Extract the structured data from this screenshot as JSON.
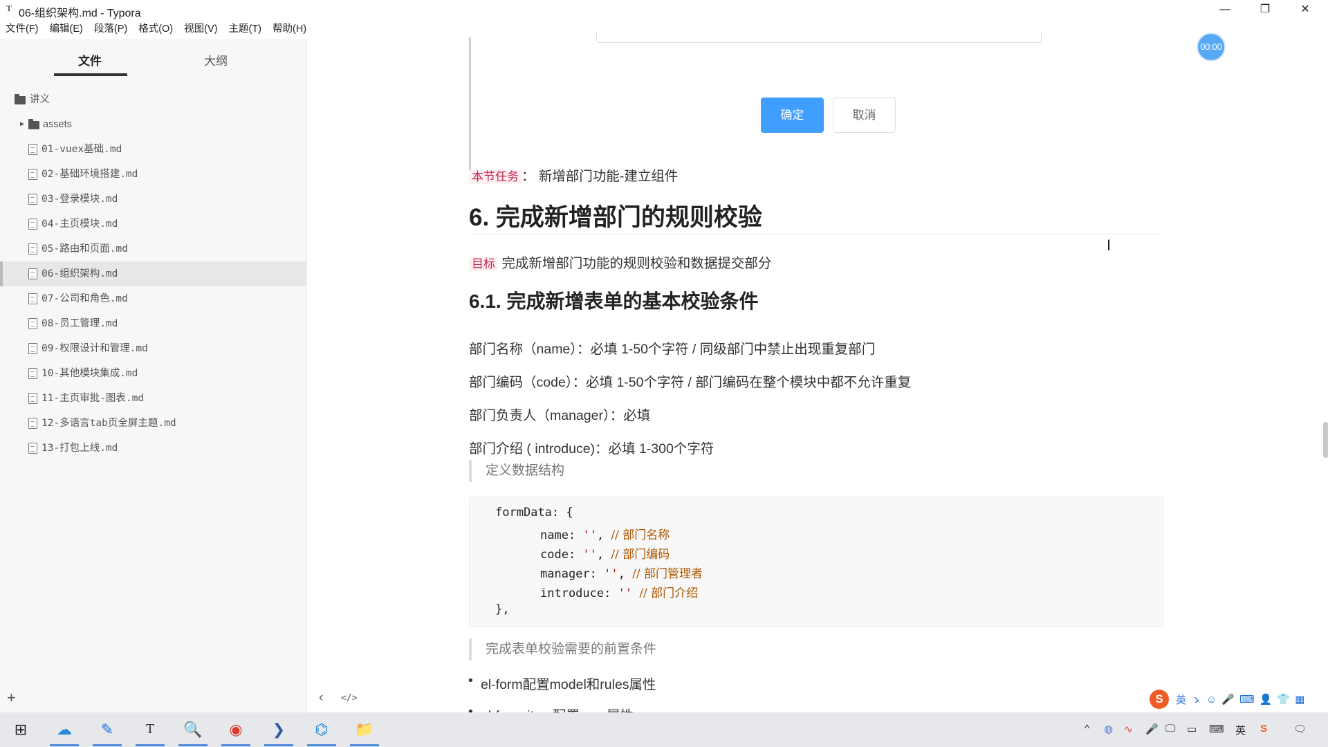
{
  "window": {
    "app_icon": "T",
    "title": "06-组织架构.md - Typora"
  },
  "window_controls": {
    "minimize": "—",
    "restore": "❐",
    "close": "✕"
  },
  "menu": [
    "文件(F)",
    "编辑(E)",
    "段落(P)",
    "格式(O)",
    "视图(V)",
    "主题(T)",
    "帮助(H)"
  ],
  "sidebar": {
    "tabs": {
      "files": "文件",
      "outline": "大纲"
    },
    "root_folder": "讲义",
    "subfolder": "assets",
    "files": [
      "01-vuex基础.md",
      "02-基础环境搭建.md",
      "03-登录模块.md",
      "04-主页模块.md",
      "05-路由和页面.md",
      "06-组织架构.md",
      "07-公司和角色.md",
      "08-员工管理.md",
      "09-权限设计和管理.md",
      "10-其他模块集成.md",
      "11-主页审批-图表.md",
      "12-多语言tab页全屏主题.md",
      "13-打包上线.md"
    ],
    "selected_index": 5,
    "add_label": "+"
  },
  "editor": {
    "timer": "00:00",
    "dialog": {
      "ok_label": "确定",
      "cancel_label": "取消"
    },
    "task": {
      "mark": "本节任务",
      "sep": "：",
      "text": " 新增部门功能-建立组件"
    },
    "h1": "6. 完成新增部门的规则校验",
    "goal": {
      "mark": "目标",
      "text": " 完成新增部门功能的规则校验和数据提交部分"
    },
    "h2": "6.1. 完成新增表单的基本校验条件",
    "rules": [
      "部门名称（name）：必填 1-50个字符  / 同级部门中禁止出现重复部门",
      "部门编码（code）：必填 1-50个字符  / 部门编码在整个模块中都不允许重复",
      "部门负责人（manager）：必填",
      "部门介绍 ( introduce)：必填 1-300个字符"
    ],
    "quote1": "定义数据结构",
    "code": {
      "l1": "formData: {",
      "fields": [
        {
          "key": "name: ",
          "val": "''",
          "tail": ", ",
          "comment": "// 部门名称"
        },
        {
          "key": "code: ",
          "val": "''",
          "tail": ", ",
          "comment": "// 部门编码"
        },
        {
          "key": "manager: ",
          "val": "''",
          "tail": ", ",
          "comment": "// 部门管理者"
        },
        {
          "key": "introduce: ",
          "val": "''",
          "tail": " ",
          "comment": "// 部门介绍"
        }
      ],
      "l_end": "},"
    },
    "quote2": "完成表单校验需要的前置条件",
    "bullets": [
      "el-form配置model和rules属性",
      "el-form-item配置prop属性"
    ],
    "footer": {
      "back": "‹",
      "source": "</>"
    }
  },
  "ime": {
    "logo": "S",
    "lang": "英",
    "items": [
      "ゝ",
      "☺",
      "🎤",
      "⌨",
      "👤",
      "👕",
      "▦"
    ]
  },
  "taskbar": {
    "apps": [
      "⊞",
      "☁",
      "✎",
      "T",
      "🔍",
      "◉",
      "❯",
      "⌬",
      "📁"
    ],
    "tray": [
      "^",
      "◍",
      "∿",
      "🎤",
      "🖵",
      "▭",
      "⌨",
      "英",
      "S",
      "🗨"
    ]
  }
}
